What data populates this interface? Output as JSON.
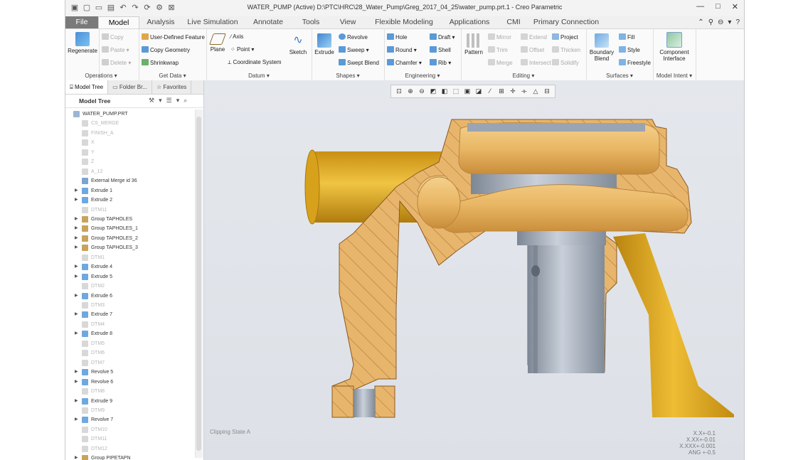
{
  "window": {
    "title": "WATER_PUMP (Active) D:\\PTC\\HRC\\28_Water_Pump\\Greg_2017_04_25\\water_pump.prt.1 - Creo Parametric",
    "controls": [
      "—",
      "□",
      "✕"
    ]
  },
  "tabs": [
    "File",
    "Model",
    "Analysis",
    "Live Simulation",
    "Annotate",
    "Tools",
    "View",
    "Flexible Modeling",
    "Applications",
    "CMI",
    "Primary Connection"
  ],
  "ribbon": {
    "operations": {
      "label": "Operations ▾",
      "regenerate": "Regenerate",
      "copy": "Copy",
      "paste": "Paste ▾",
      "delete": "Delete ▾"
    },
    "getdata": {
      "label": "Get Data ▾",
      "udf": "User-Defined Feature",
      "copygeom": "Copy Geometry",
      "shrinkwrap": "Shrinkwrap"
    },
    "datum": {
      "label": "Datum ▾",
      "plane": "Plane",
      "axis": "Axis",
      "point": "Point ▾",
      "csys": "Coordinate System",
      "sketch": "Sketch"
    },
    "shapes": {
      "label": "Shapes ▾",
      "extrude": "Extrude",
      "revolve": "Revolve",
      "sweep": "Sweep ▾",
      "sweptblend": "Swept Blend"
    },
    "engineering": {
      "label": "Engineering ▾",
      "hole": "Hole",
      "draft": "Draft ▾",
      "round": "Round ▾",
      "shell": "Shell",
      "chamfer": "Chamfer ▾",
      "rib": "Rib ▾"
    },
    "editing": {
      "label": "Editing ▾",
      "pattern": "Pattern",
      "mirror": "Mirror",
      "extend": "Extend",
      "project": "Project",
      "trim": "Trim",
      "offset": "Offset",
      "thicken": "Thicken",
      "merge": "Merge",
      "intersect": "Intersect",
      "solidify": "Solidify"
    },
    "surfaces": {
      "label": "Surfaces ▾",
      "boundary": "Boundary Blend",
      "fill": "Fill",
      "style": "Style",
      "freestyle": "Freestyle"
    },
    "modelintent": {
      "label": "Model Intent ▾",
      "component": "Component Interface"
    }
  },
  "panel": {
    "tabs": [
      "Model Tree",
      "Folder Br...",
      "Favorites"
    ],
    "header": "Model Tree",
    "items": [
      {
        "label": "WATER_PUMP.PRT",
        "dim": false,
        "expand": false,
        "icon": "part"
      },
      {
        "label": "CS_MERGE",
        "dim": true,
        "expand": false,
        "icon": "datum"
      },
      {
        "label": "FINISH_A",
        "dim": true,
        "expand": false,
        "icon": "datum"
      },
      {
        "label": "X",
        "dim": true,
        "expand": false,
        "icon": "datum"
      },
      {
        "label": "Y",
        "dim": true,
        "expand": false,
        "icon": "datum"
      },
      {
        "label": "Z",
        "dim": true,
        "expand": false,
        "icon": "datum"
      },
      {
        "label": "A_12",
        "dim": true,
        "expand": false,
        "icon": "datum"
      },
      {
        "label": "External Merge id 36",
        "dim": false,
        "expand": false,
        "icon": "merge"
      },
      {
        "label": "Extrude 1",
        "dim": false,
        "expand": true,
        "icon": "extrude"
      },
      {
        "label": "Extrude 2",
        "dim": false,
        "expand": true,
        "icon": "extrude"
      },
      {
        "label": "DTM11",
        "dim": true,
        "expand": false,
        "icon": "datum"
      },
      {
        "label": "Group TAPHOLES",
        "dim": false,
        "expand": true,
        "icon": "group"
      },
      {
        "label": "Group TAPHOLES_1",
        "dim": false,
        "expand": true,
        "icon": "group"
      },
      {
        "label": "Group TAPHOLES_2",
        "dim": false,
        "expand": true,
        "icon": "group"
      },
      {
        "label": "Group TAPHOLES_3",
        "dim": false,
        "expand": true,
        "icon": "group"
      },
      {
        "label": "DTM1",
        "dim": true,
        "expand": false,
        "icon": "datum"
      },
      {
        "label": "Extrude 4",
        "dim": false,
        "expand": true,
        "icon": "extrude"
      },
      {
        "label": "Extrude 5",
        "dim": false,
        "expand": true,
        "icon": "extrude"
      },
      {
        "label": "DTM2",
        "dim": true,
        "expand": false,
        "icon": "datum"
      },
      {
        "label": "Extrude 6",
        "dim": false,
        "expand": true,
        "icon": "extrude"
      },
      {
        "label": "DTM3",
        "dim": true,
        "expand": false,
        "icon": "datum"
      },
      {
        "label": "Extrude 7",
        "dim": false,
        "expand": true,
        "icon": "extrude"
      },
      {
        "label": "DTM4",
        "dim": true,
        "expand": false,
        "icon": "datum"
      },
      {
        "label": "Extrude 8",
        "dim": false,
        "expand": true,
        "icon": "extrude"
      },
      {
        "label": "DTM5",
        "dim": true,
        "expand": false,
        "icon": "datum"
      },
      {
        "label": "DTM6",
        "dim": true,
        "expand": false,
        "icon": "datum"
      },
      {
        "label": "DTM7",
        "dim": true,
        "expand": false,
        "icon": "datum"
      },
      {
        "label": "Revolve 5",
        "dim": false,
        "expand": true,
        "icon": "revolve"
      },
      {
        "label": "Revolve 6",
        "dim": false,
        "expand": true,
        "icon": "revolve"
      },
      {
        "label": "DTM8",
        "dim": true,
        "expand": false,
        "icon": "datum"
      },
      {
        "label": "Extrude 9",
        "dim": false,
        "expand": true,
        "icon": "extrude"
      },
      {
        "label": "DTM9",
        "dim": true,
        "expand": false,
        "icon": "datum"
      },
      {
        "label": "Revolve 7",
        "dim": false,
        "expand": true,
        "icon": "revolve"
      },
      {
        "label": "DTM10",
        "dim": true,
        "expand": false,
        "icon": "datum"
      },
      {
        "label": "DTM11",
        "dim": true,
        "expand": false,
        "icon": "datum"
      },
      {
        "label": "DTM12",
        "dim": true,
        "expand": false,
        "icon": "datum"
      },
      {
        "label": "Group PIPETAPN",
        "dim": false,
        "expand": true,
        "icon": "group"
      }
    ]
  },
  "viewport": {
    "clip_state": "Clipping State A",
    "tolerances": [
      "X.X+-0.1",
      "X.XX+-0.01",
      "X.XXX+-0.001",
      "ANG +-0.5"
    ]
  },
  "colors": {
    "cut": "#e8b56c",
    "hatch": "#a86e2e",
    "yellow": "#e1ad1d",
    "steel": "#9aa4b3",
    "accent": "#2e74c8"
  }
}
